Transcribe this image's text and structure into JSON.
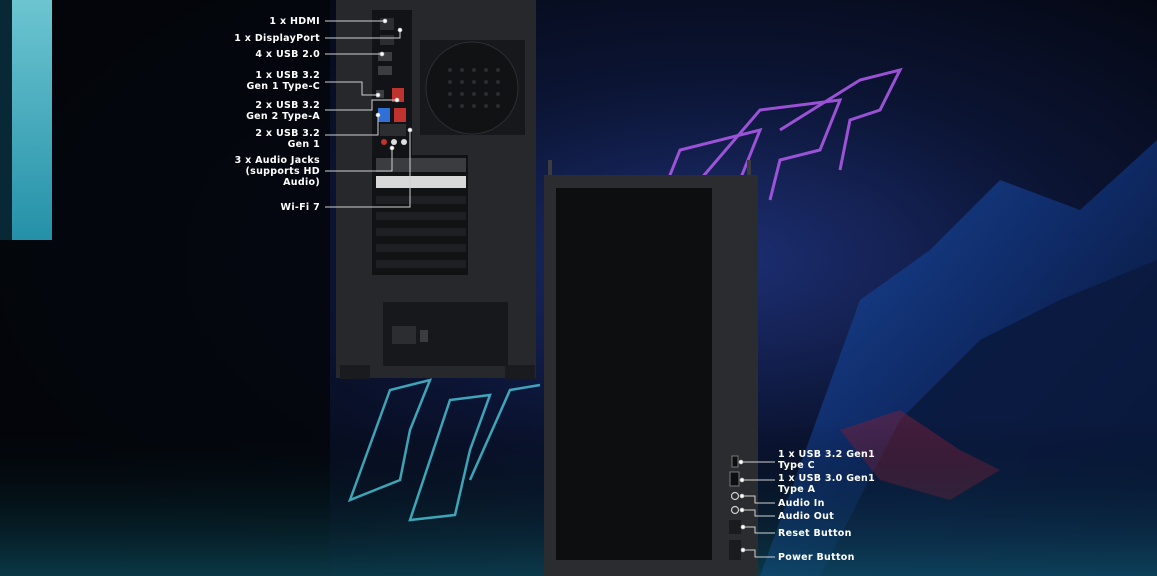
{
  "rear_labels": [
    {
      "lines": [
        "1 x HDMI"
      ]
    },
    {
      "lines": [
        "1 x DisplayPort"
      ]
    },
    {
      "lines": [
        "4 x USB 2.0"
      ]
    },
    {
      "lines": [
        "1 x USB 3.2",
        "Gen 1 Type-C"
      ]
    },
    {
      "lines": [
        "2 x USB 3.2",
        "Gen 2 Type-A"
      ]
    },
    {
      "lines": [
        "2 x USB 3.2",
        "Gen 1"
      ]
    },
    {
      "lines": [
        "3 x Audio Jacks",
        "(supports  HD",
        "Audio)"
      ]
    },
    {
      "lines": [
        "Wi-Fi 7"
      ]
    }
  ],
  "front_labels": [
    {
      "lines": [
        "1 x USB 3.2 Gen1",
        "Type C"
      ]
    },
    {
      "lines": [
        "1 x USB 3.0 Gen1",
        "Type A"
      ]
    },
    {
      "lines": [
        "Audio In"
      ]
    },
    {
      "lines": [
        "Audio Out"
      ]
    },
    {
      "lines": [
        "Reset Button"
      ]
    },
    {
      "lines": [
        "Power Button"
      ]
    }
  ],
  "colors": {
    "background": "#05070d",
    "neon_purple": "#b45cf0",
    "neon_cyan": "#4fd6e8",
    "case": "#26282c",
    "case_dark": "#141518",
    "accent_red": "#c0322d",
    "accent_blue": "#2f6fd6"
  }
}
